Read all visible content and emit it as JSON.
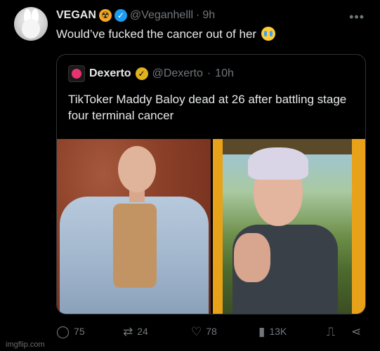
{
  "tweet": {
    "author_name": "VEGAN",
    "author_handle": "@Veganhelll",
    "separator": "·",
    "time": "9h",
    "text": "Would’ve fucked the cancer out of her"
  },
  "quoted": {
    "author_name": "Dexerto",
    "author_handle": "@Dexerto",
    "separator": "·",
    "time": "10h",
    "text": "TikToker Maddy Baloy dead at 26 after battling stage four terminal cancer"
  },
  "actions": {
    "replies": "75",
    "reposts": "24",
    "likes": "78",
    "views": "13K"
  },
  "icons": {
    "more": "more-icon",
    "reply": "reply-icon",
    "repost": "repost-icon",
    "like": "heart-icon",
    "views": "views-icon",
    "bookmark": "bookmark-icon",
    "share": "share-icon"
  },
  "colors": {
    "background": "#000000",
    "text": "#e7e9ea",
    "muted": "#71767b",
    "verified_blue": "#1d9bf0",
    "verified_gold": "#e2b11e"
  },
  "watermark": "imgflip.com"
}
